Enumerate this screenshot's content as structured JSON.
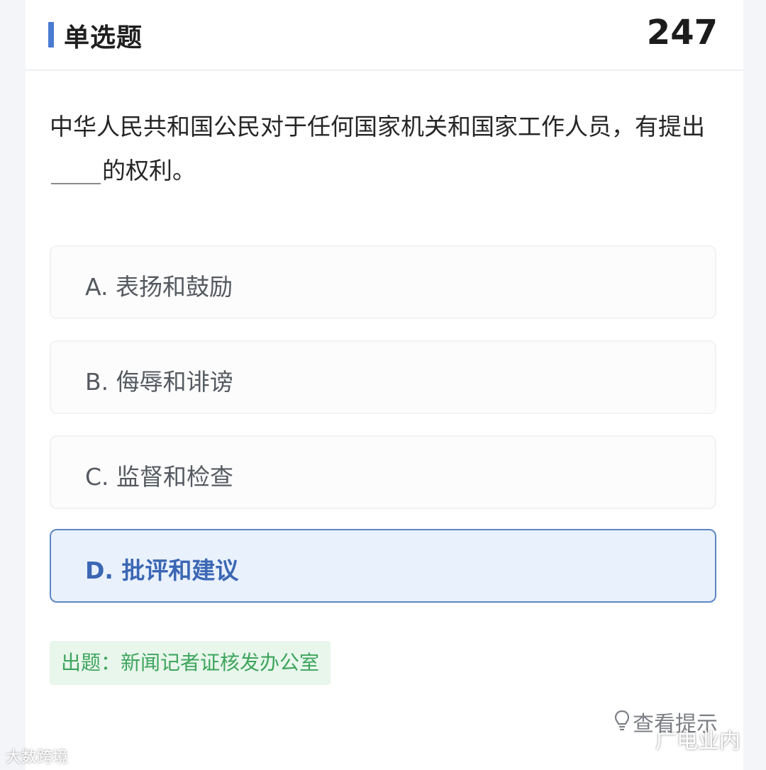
{
  "header": {
    "title": "单选题",
    "number": "247"
  },
  "question": {
    "text_before": "中华人民共和国公民对于任何国家机关和国家工作人员，有提出",
    "text_after": "的权利。"
  },
  "options": [
    {
      "label": "A. 表扬和鼓励",
      "selected": false
    },
    {
      "label": "B. 侮辱和诽谤",
      "selected": false
    },
    {
      "label": "C. 监督和检查",
      "selected": false
    },
    {
      "label": "D. 批评和建议",
      "selected": true
    }
  ],
  "source": "出题：新闻记者证核发办公室",
  "hint": {
    "icon": "lightbulb-icon",
    "label": "查看提示"
  },
  "watermarks": {
    "left": "大数跨境",
    "right": "广电业内"
  },
  "colors": {
    "accent": "#4a7bd2",
    "selected_bg": "#e9f1fd",
    "selected_text": "#3b67b4",
    "source_bg": "#e8f6ec",
    "source_text": "#3ea55c"
  }
}
